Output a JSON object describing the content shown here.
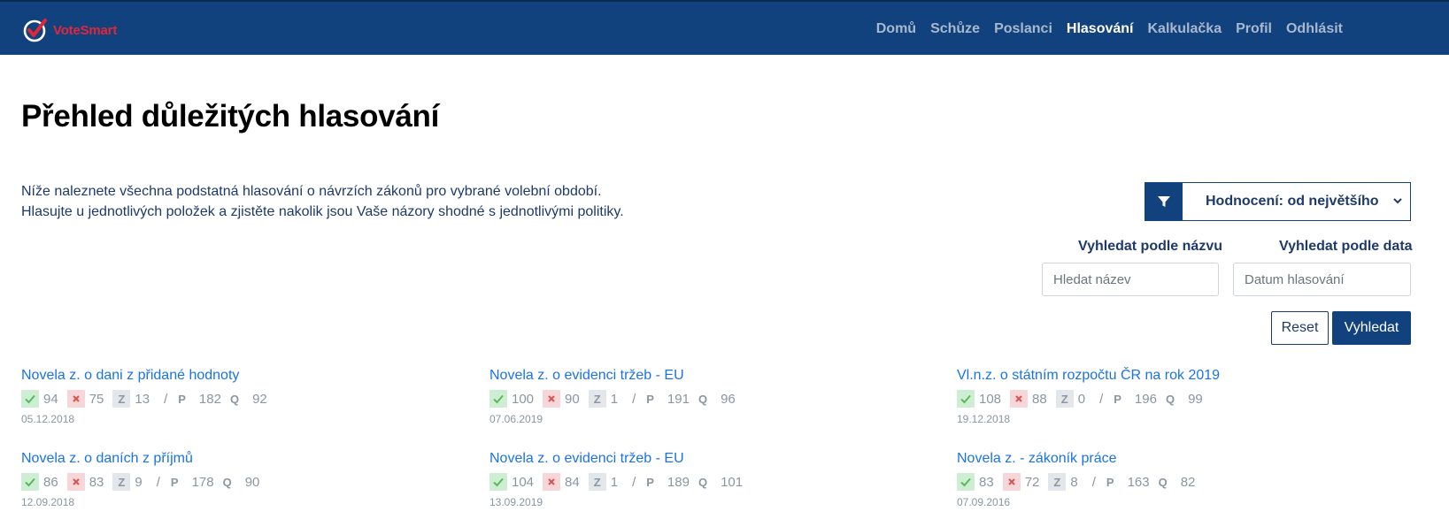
{
  "app": {
    "brand_name": "VoteSmart",
    "brand_color": "#e0263a",
    "nav_color": "#12427d"
  },
  "nav": {
    "items": [
      {
        "label": "Domů",
        "active": false
      },
      {
        "label": "Schůze",
        "active": false
      },
      {
        "label": "Poslanci",
        "active": false
      },
      {
        "label": "Hlasování",
        "active": true
      },
      {
        "label": "Kalkulačka",
        "active": false
      },
      {
        "label": "Profil",
        "active": false
      },
      {
        "label": "Odhlásit",
        "active": false
      }
    ]
  },
  "page": {
    "title": "Přehled důležitých hlasování",
    "intro_line1": "Níže naleznete všechna podstatná hlasování o návrzích zákonů pro vybrané volební období.",
    "intro_line2": "Hlasujte u jednotlivých položek a zjistěte nakolik jsou Vaše názory shodné s jednotlivými politiky."
  },
  "filters": {
    "filter_icon": "funnel-icon",
    "sort_selected": "Hodnocení: od největšího",
    "search_name_label": "Vyhledat podle názvu",
    "search_name_placeholder": "Hledat název",
    "search_date_label": "Vyhledat podle data",
    "search_date_placeholder": "Datum hlasování",
    "reset_label": "Reset",
    "search_label": "Vyhledat"
  },
  "votes": [
    {
      "title": "Novela z. o dani z přidané hodnoty",
      "yes": "94",
      "no": "75",
      "abstain": "13",
      "p": "182",
      "q": "92",
      "date": "05.12.2018"
    },
    {
      "title": "Novela z. o evidenci tržeb - EU",
      "yes": "100",
      "no": "90",
      "abstain": "1",
      "p": "191",
      "q": "96",
      "date": "07.06.2019"
    },
    {
      "title": "Vl.n.z. o státním rozpočtu ČR na rok 2019",
      "yes": "108",
      "no": "88",
      "abstain": "0",
      "p": "196",
      "q": "99",
      "date": "19.12.2018"
    },
    {
      "title": "Novela z. o daních z příjmů",
      "yes": "86",
      "no": "83",
      "abstain": "9",
      "p": "178",
      "q": "90",
      "date": "12.09.2018"
    },
    {
      "title": "Novela z. o evidenci tržeb - EU",
      "yes": "104",
      "no": "84",
      "abstain": "1",
      "p": "189",
      "q": "101",
      "date": "13.09.2019"
    },
    {
      "title": "Novela z. - zákoník práce",
      "yes": "83",
      "no": "72",
      "abstain": "8",
      "p": "163",
      "q": "82",
      "date": "07.09.2016"
    }
  ],
  "stat_labels": {
    "yes_icon": "check-icon",
    "no_icon": "cross-icon",
    "abstain_letter": "Z",
    "separator": "/",
    "p_letter": "P",
    "q_letter": "Q"
  }
}
